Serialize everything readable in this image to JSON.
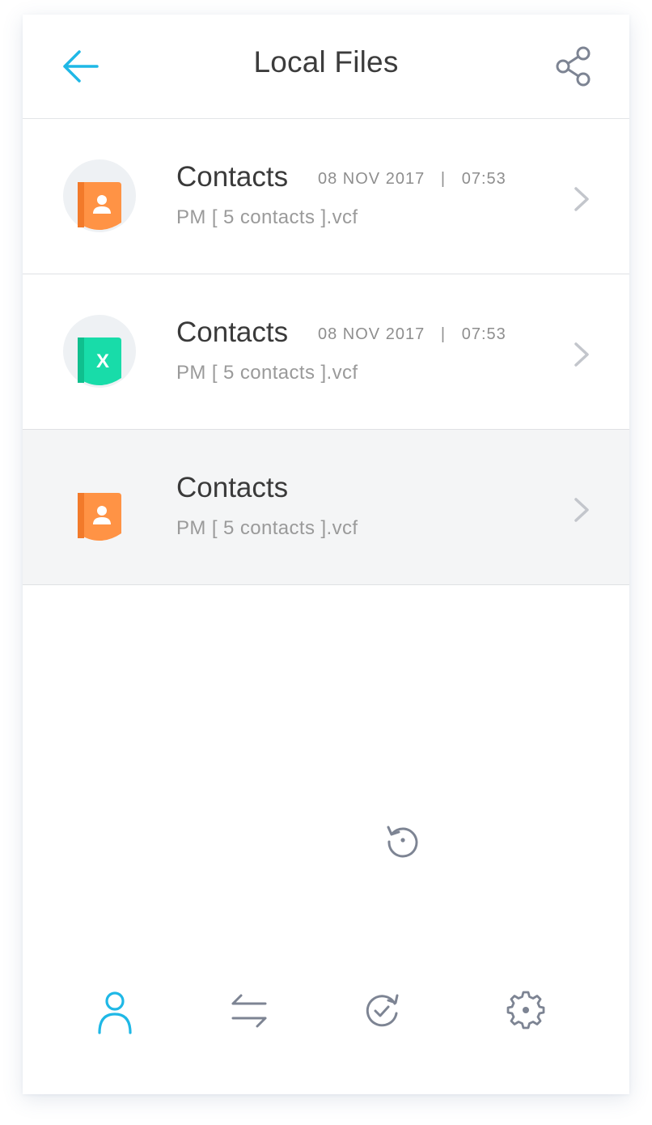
{
  "header": {
    "title": "Local Files",
    "back_icon": "arrow-left-icon",
    "share_icon": "share-icon"
  },
  "files": [
    {
      "name": "Contacts",
      "date": "08 NOV 2017",
      "separator": "|",
      "time": "07:53",
      "subtitle": "PM [ 5 contacts ].vcf",
      "icon": "contact-book-icon",
      "icon_color": "#ff9345"
    },
    {
      "name": "Contacts",
      "date": "08 NOV 2017",
      "separator": "|",
      "time": "07:53",
      "subtitle": "PM [ 5 contacts ].vcf",
      "icon": "excel-book-icon",
      "icon_letter": "X",
      "icon_color": "#18dca9"
    },
    {
      "name": "Contacts",
      "subtitle": "PM [ 5 contacts ].vcf",
      "icon": "contact-book-icon",
      "icon_color": "#ff9345",
      "selected": true
    }
  ],
  "restore": {
    "icon": "restore-icon"
  },
  "tabbar": {
    "active": "contacts",
    "tabs": [
      {
        "id": "contacts",
        "icon": "user-icon"
      },
      {
        "id": "transfer",
        "icon": "transfer-icon"
      },
      {
        "id": "sync",
        "icon": "sync-check-icon"
      },
      {
        "id": "settings",
        "icon": "gear-icon"
      }
    ]
  },
  "colors": {
    "accent": "#1fb8e6",
    "icon_gray": "#7d8493",
    "chevron": "#c3c6cc",
    "orange": "#ff9345",
    "green": "#18dca9"
  }
}
